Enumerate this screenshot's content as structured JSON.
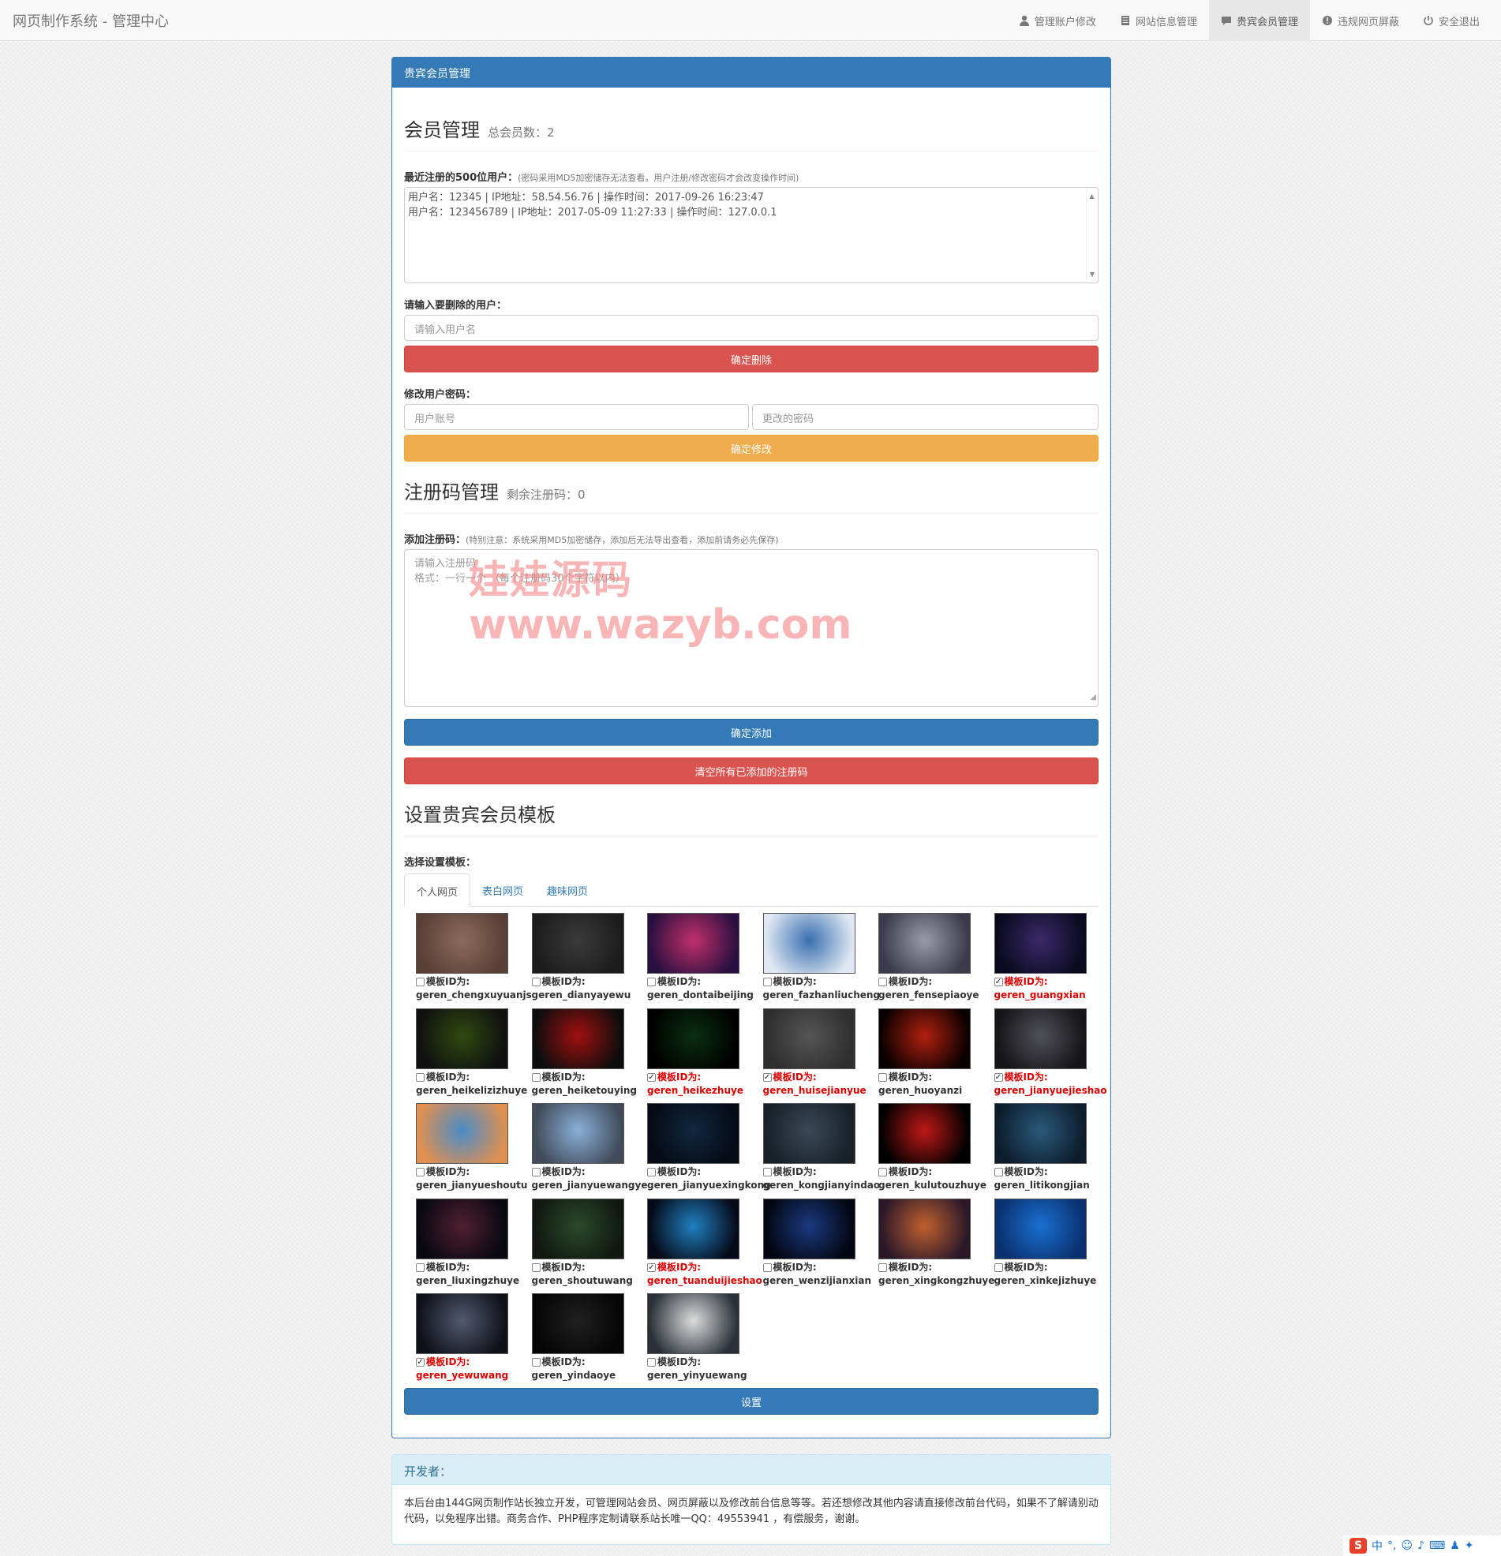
{
  "app_title": "网页制作系统 - 管理中心",
  "nav": [
    {
      "label": "管理账户修改",
      "icon": "user-icon"
    },
    {
      "label": "网站信息管理",
      "icon": "document-icon"
    },
    {
      "label": "贵宾会员管理",
      "icon": "comment-icon",
      "active": true
    },
    {
      "label": "违规网页屏蔽",
      "icon": "exclamation-circle-icon"
    },
    {
      "label": "安全退出",
      "icon": "power-icon"
    }
  ],
  "panel_title": "贵宾会员管理",
  "members": {
    "heading": "会员管理",
    "total": "总会员数：2",
    "recent_label": "最近注册的500位用户：",
    "recent_note": "(密码采用MD5加密储存无法查看。用户注册/修改密码才会改变操作时间)",
    "recent_lines": [
      "用户名：12345  |  IP地址：58.54.56.76  |  操作时间：2017-09-26 16:23:47",
      "用户名：123456789  |  IP地址：2017-05-09 11:27:33  |  操作时间：127.0.0.1"
    ],
    "delete_label": "请输入要删除的用户：",
    "delete_placeholder": "请输入用户名",
    "delete_button": "确定删除",
    "change_label": "修改用户密码：",
    "account_placeholder": "用户账号",
    "password_placeholder": "更改的密码",
    "change_button": "确定修改"
  },
  "codes": {
    "heading": "注册码管理",
    "remaining": "剩余注册码：0",
    "add_label": "添加注册码：",
    "add_note": "(特别注意：系统采用MD5加密储存，添加后无法导出查看，添加前请务必先保存)",
    "placeholder_line1": "请输入注册码",
    "placeholder_line2": "格式：一行一个 （每个注册码30个字符以内）",
    "add_button": "确定添加",
    "clear_button": "清空所有已添加的注册码"
  },
  "templates": {
    "heading": "设置贵宾会员模板",
    "select_label": "选择设置模板：",
    "tabs": [
      "个人网页",
      "表白网页",
      "趣味网页"
    ],
    "id_prefix": "模板ID为:",
    "items": [
      {
        "name": "geren_chengxuyuanjs",
        "checked": false,
        "colors": [
          "#8b6b5e",
          "#5a3f35"
        ]
      },
      {
        "name": "geren_dianyayewu",
        "checked": false,
        "colors": [
          "#3a3a3a",
          "#1c1c1c"
        ]
      },
      {
        "name": "geren_dontaibeijing",
        "checked": false,
        "colors": [
          "#c0306a",
          "#2a1040"
        ]
      },
      {
        "name": "geren_fazhanliucheng",
        "checked": false,
        "colors": [
          "#3a6fb0",
          "#dfe8f2"
        ]
      },
      {
        "name": "geren_fensepiaoye",
        "checked": false,
        "colors": [
          "#9a9aa8",
          "#3a3a48"
        ]
      },
      {
        "name": "geren_guangxian",
        "checked": true,
        "colors": [
          "#3a2a6a",
          "#0a0a1e"
        ]
      },
      {
        "name": "geren_heikelizizhuye",
        "checked": false,
        "colors": [
          "#2e4a10",
          "#101010"
        ]
      },
      {
        "name": "geren_heiketouying",
        "checked": false,
        "colors": [
          "#a01010",
          "#0d0d0d"
        ]
      },
      {
        "name": "geren_heikezhuye",
        "checked": true,
        "colors": [
          "#0a3010",
          "#000000"
        ]
      },
      {
        "name": "geren_huisejianyue",
        "checked": true,
        "colors": [
          "#555555",
          "#2e2e2e"
        ]
      },
      {
        "name": "geren_huoyanzi",
        "checked": false,
        "colors": [
          "#b02010",
          "#0a0000"
        ]
      },
      {
        "name": "geren_jianyuejieshao",
        "checked": true,
        "colors": [
          "#505058",
          "#151518"
        ]
      },
      {
        "name": "geren_jianyueshoutu",
        "checked": false,
        "colors": [
          "#4a8cc8",
          "#e09050"
        ]
      },
      {
        "name": "geren_jianyuewangye",
        "checked": false,
        "colors": [
          "#8ab0d8",
          "#404a58"
        ]
      },
      {
        "name": "geren_jianyuexingkong",
        "checked": false,
        "colors": [
          "#102840",
          "#050a14"
        ]
      },
      {
        "name": "geren_kongjianyindao",
        "checked": false,
        "colors": [
          "#3a4858",
          "#182028"
        ]
      },
      {
        "name": "geren_kulutouzhuye",
        "checked": false,
        "colors": [
          "#c01818",
          "#000000"
        ]
      },
      {
        "name": "geren_litikongjian",
        "checked": false,
        "colors": [
          "#2a5a7a",
          "#0d1c2c"
        ]
      },
      {
        "name": "geren_liuxingzhuye",
        "checked": false,
        "colors": [
          "#502030",
          "#080810"
        ]
      },
      {
        "name": "geren_shoutuwang",
        "checked": false,
        "colors": [
          "#2a4a2a",
          "#101810"
        ]
      },
      {
        "name": "geren_tuanduijieshao",
        "checked": true,
        "colors": [
          "#2080c0",
          "#050a18"
        ]
      },
      {
        "name": "geren_wenzijianxian",
        "checked": false,
        "colors": [
          "#1a3a80",
          "#030610"
        ]
      },
      {
        "name": "geren_xingkongzhuye",
        "checked": false,
        "colors": [
          "#c06030",
          "#2a1828"
        ]
      },
      {
        "name": "geren_xinkejizhuye",
        "checked": false,
        "colors": [
          "#1a70d0",
          "#0a3070"
        ]
      },
      {
        "name": "geren_yewuwang",
        "checked": true,
        "colors": [
          "#505a70",
          "#101018"
        ]
      },
      {
        "name": "geren_yindaoye",
        "checked": false,
        "colors": [
          "#202020",
          "#050505"
        ]
      },
      {
        "name": "geren_yinyuewang",
        "checked": false,
        "colors": [
          "#dcdcdc",
          "#2a3038"
        ]
      }
    ],
    "submit_button": "设置"
  },
  "developer": {
    "heading": "开发者：",
    "text": "本后台由144G网页制作站长独立开发，可管理网站会员、网页屏蔽以及修改前台信息等等。若还想修改其他内容请直接修改前台代码，如果不了解请别动代码，以免程序出错。商务合作、PHP程序定制请联系站长唯一QQ：49553941 ，有偿服务，谢谢。"
  },
  "watermark": {
    "line1": "娃娃源码",
    "line2": "www.wazyb.com"
  },
  "tray": {
    "ime": "中"
  }
}
